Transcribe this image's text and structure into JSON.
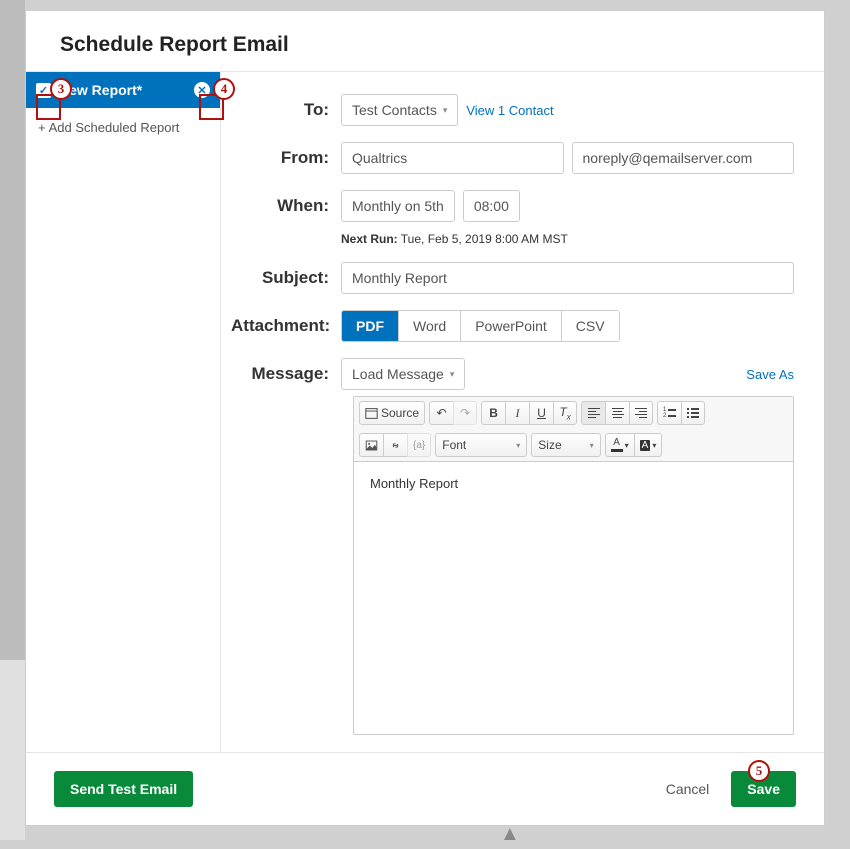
{
  "title": "Schedule Report Email",
  "sidebar": {
    "tab_label": "New Report*",
    "add_label": "Add Scheduled Report"
  },
  "form": {
    "to_label": "To:",
    "to_value": "Test Contacts",
    "view_contacts": "View 1 Contact",
    "from_label": "From:",
    "from_name": "Qualtrics",
    "from_email": "noreply@qemailserver.com",
    "when_label": "When:",
    "when_freq": "Monthly on 5th",
    "when_time": "08:00",
    "next_run_label": "Next Run:",
    "next_run_value": "Tue, Feb 5, 2019 8:00 AM MST",
    "subject_label": "Subject:",
    "subject_value": "Monthly Report",
    "attachment_label": "Attachment:",
    "attach_pdf": "PDF",
    "attach_word": "Word",
    "attach_ppt": "PowerPoint",
    "attach_csv": "CSV",
    "message_label": "Message:",
    "load_message": "Load Message",
    "save_as": "Save As",
    "editor_content": "Monthly Report"
  },
  "toolbar": {
    "source": "Source",
    "font": "Font",
    "size": "Size"
  },
  "footer": {
    "send_test": "Send Test Email",
    "cancel": "Cancel",
    "save": "Save"
  },
  "annotations": {
    "n3": "3",
    "n4": "4",
    "n5": "5"
  }
}
